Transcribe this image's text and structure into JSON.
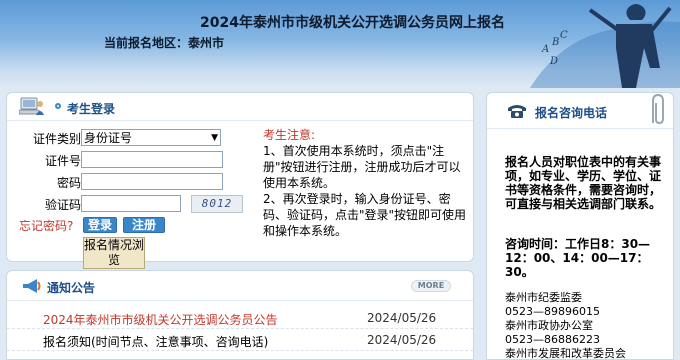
{
  "header": {
    "title": "2024年泰州市市级机关公开选调公务员网上报名",
    "region_label": "当前报名地区：",
    "region_value": "泰州市",
    "decor_letters": [
      "A",
      "B",
      "C",
      "D"
    ]
  },
  "login": {
    "section_title": "考生登录",
    "id_type_label": "证件类别",
    "id_type_value": "身份证号",
    "id_number_label": "证件号",
    "password_label": "密码",
    "captcha_label": "验证码",
    "captcha_text": "8012",
    "forgot_link": "忘记密码?",
    "login_button": "登录",
    "register_button": "注册",
    "status_button": "报名情况浏览",
    "notes_title": "考生注意:",
    "notes_1": "1、首次使用本系统时，须点击\"注册\"按钮进行注册，注册成功后才可以使用本系统。",
    "notes_2": "2、再次登录时，输入身份证号、密码、验证码，点击\"登录\"按钮即可使用和操作本系统。"
  },
  "notice": {
    "section_title": "通知公告",
    "more_label": "MORE",
    "items": [
      {
        "title": "2024年泰州市市级机关公开选调公务员公告",
        "date": "2024/05/26"
      },
      {
        "title": "报名须知(时间节点、注意事项、咨询电话)",
        "date": "2024/05/26"
      }
    ]
  },
  "sidebar": {
    "title": "报名咨询电话",
    "intro": "报名人员对职位表中的有关事项，如专业、学历、学位、证书等资格条件，需要咨询时，可直接与相关选调部门联系。",
    "hours": "咨询时间：工作日8：30—12：00、14：00—17：30。",
    "contacts": [
      {
        "org": "泰州市纪委监委",
        "phone": "0523—89896015"
      },
      {
        "org": "泰州市政协办公室",
        "phone": "0523—86886223"
      },
      {
        "org": "泰州市发展和改革委员会",
        "phone": ""
      }
    ]
  },
  "colors": {
    "accent": "#3a86c8",
    "warning": "#c0392b",
    "brand_dark": "#1f4f88"
  }
}
